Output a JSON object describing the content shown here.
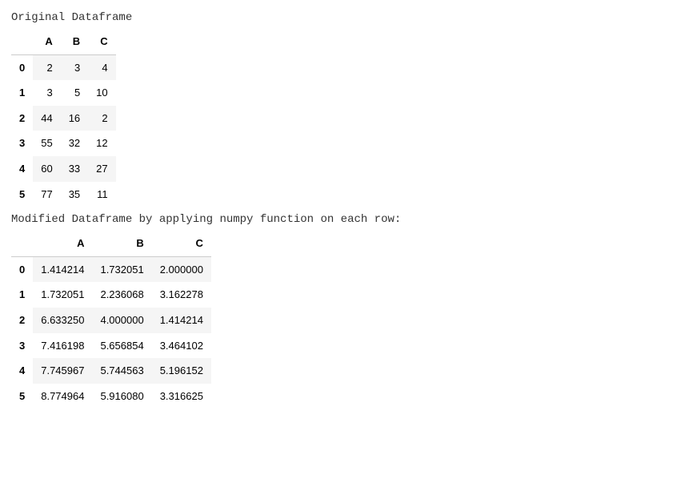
{
  "label_original": "Original Dataframe",
  "label_modified": "Modified Dataframe by applying numpy function on each row:",
  "table1": {
    "columns": [
      "A",
      "B",
      "C"
    ],
    "index": [
      "0",
      "1",
      "2",
      "3",
      "4",
      "5"
    ],
    "rows": [
      [
        "2",
        "3",
        "4"
      ],
      [
        "3",
        "5",
        "10"
      ],
      [
        "44",
        "16",
        "2"
      ],
      [
        "55",
        "32",
        "12"
      ],
      [
        "60",
        "33",
        "27"
      ],
      [
        "77",
        "35",
        "11"
      ]
    ]
  },
  "table2": {
    "columns": [
      "A",
      "B",
      "C"
    ],
    "index": [
      "0",
      "1",
      "2",
      "3",
      "4",
      "5"
    ],
    "rows": [
      [
        "1.414214",
        "1.732051",
        "2.000000"
      ],
      [
        "1.732051",
        "2.236068",
        "3.162278"
      ],
      [
        "6.633250",
        "4.000000",
        "1.414214"
      ],
      [
        "7.416198",
        "5.656854",
        "3.464102"
      ],
      [
        "7.745967",
        "5.744563",
        "5.196152"
      ],
      [
        "8.774964",
        "5.916080",
        "3.316625"
      ]
    ]
  },
  "chart_data": [
    {
      "type": "table",
      "title": "Original Dataframe",
      "columns": [
        "A",
        "B",
        "C"
      ],
      "index": [
        0,
        1,
        2,
        3,
        4,
        5
      ],
      "data": [
        [
          2,
          3,
          4
        ],
        [
          3,
          5,
          10
        ],
        [
          44,
          16,
          2
        ],
        [
          55,
          32,
          12
        ],
        [
          60,
          33,
          27
        ],
        [
          77,
          35,
          11
        ]
      ]
    },
    {
      "type": "table",
      "title": "Modified Dataframe by applying numpy function on each row",
      "columns": [
        "A",
        "B",
        "C"
      ],
      "index": [
        0,
        1,
        2,
        3,
        4,
        5
      ],
      "data": [
        [
          1.414214,
          1.732051,
          2.0
        ],
        [
          1.732051,
          2.236068,
          3.162278
        ],
        [
          6.63325,
          4.0,
          1.414214
        ],
        [
          7.416198,
          5.656854,
          3.464102
        ],
        [
          7.745967,
          5.744563,
          5.196152
        ],
        [
          8.774964,
          5.91608,
          3.316625
        ]
      ]
    }
  ]
}
